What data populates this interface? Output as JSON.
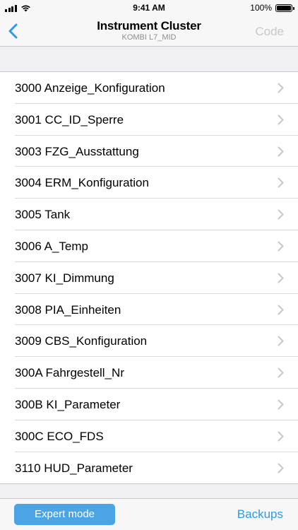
{
  "status_bar": {
    "time": "9:41 AM",
    "battery_text": "100%",
    "battery_level": 1.0,
    "icons": [
      "signal-icon",
      "wifi-icon",
      "battery-icon"
    ]
  },
  "nav": {
    "title": "Instrument Cluster",
    "subtitle": "KOMBI L7_MID",
    "code_label": "Code",
    "back_icon": "chevron-left-icon"
  },
  "items": [
    {
      "label": "3000 Anzeige_Konfiguration"
    },
    {
      "label": "3001 CC_ID_Sperre"
    },
    {
      "label": "3003 FZG_Ausstattung"
    },
    {
      "label": "3004 ERM_Konfiguration"
    },
    {
      "label": "3005 Tank"
    },
    {
      "label": "3006 A_Temp"
    },
    {
      "label": "3007 KI_Dimmung"
    },
    {
      "label": "3008 PIA_Einheiten"
    },
    {
      "label": "3009 CBS_Konfiguration"
    },
    {
      "label": "300A Fahrgestell_Nr"
    },
    {
      "label": "300B KI_Parameter"
    },
    {
      "label": "300C ECO_FDS"
    },
    {
      "label": "3110 HUD_Parameter"
    }
  ],
  "toolbar": {
    "expert_label": "Expert mode",
    "backups_label": "Backups"
  },
  "colors": {
    "accent": "#2f9ae0",
    "button_fill": "#4aa4e6",
    "disabled": "#c7c7cc",
    "background": "#efeff4"
  }
}
